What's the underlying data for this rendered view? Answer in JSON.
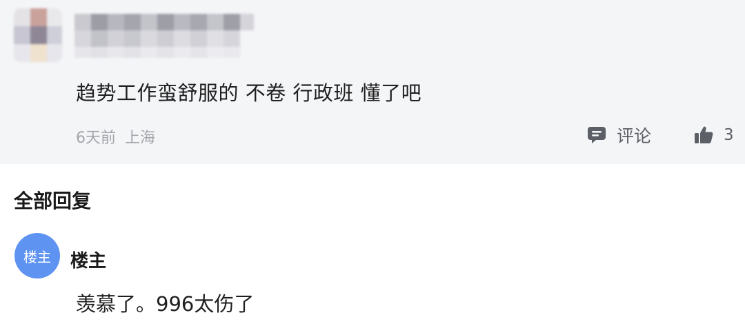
{
  "comment": {
    "author_redacted": true,
    "text": "趋势工作蛮舒服的 不卷 行政班 懂了吧",
    "time": "6天前",
    "location": "上海",
    "reply_label": "评论",
    "like_count": "3",
    "icons": {
      "reply": "comment-icon",
      "like": "thumbs-up-icon"
    }
  },
  "replies_section": {
    "title": "全部回复",
    "items": [
      {
        "avatar_text": "楼主",
        "author": "楼主",
        "text": "羡慕了。996太伤了"
      }
    ]
  },
  "colors": {
    "card_background": "#f4f5f7",
    "avatar_blue": "#5f93f2",
    "meta_gray": "#a3a5ab",
    "icon_gray": "#5c5f66"
  }
}
